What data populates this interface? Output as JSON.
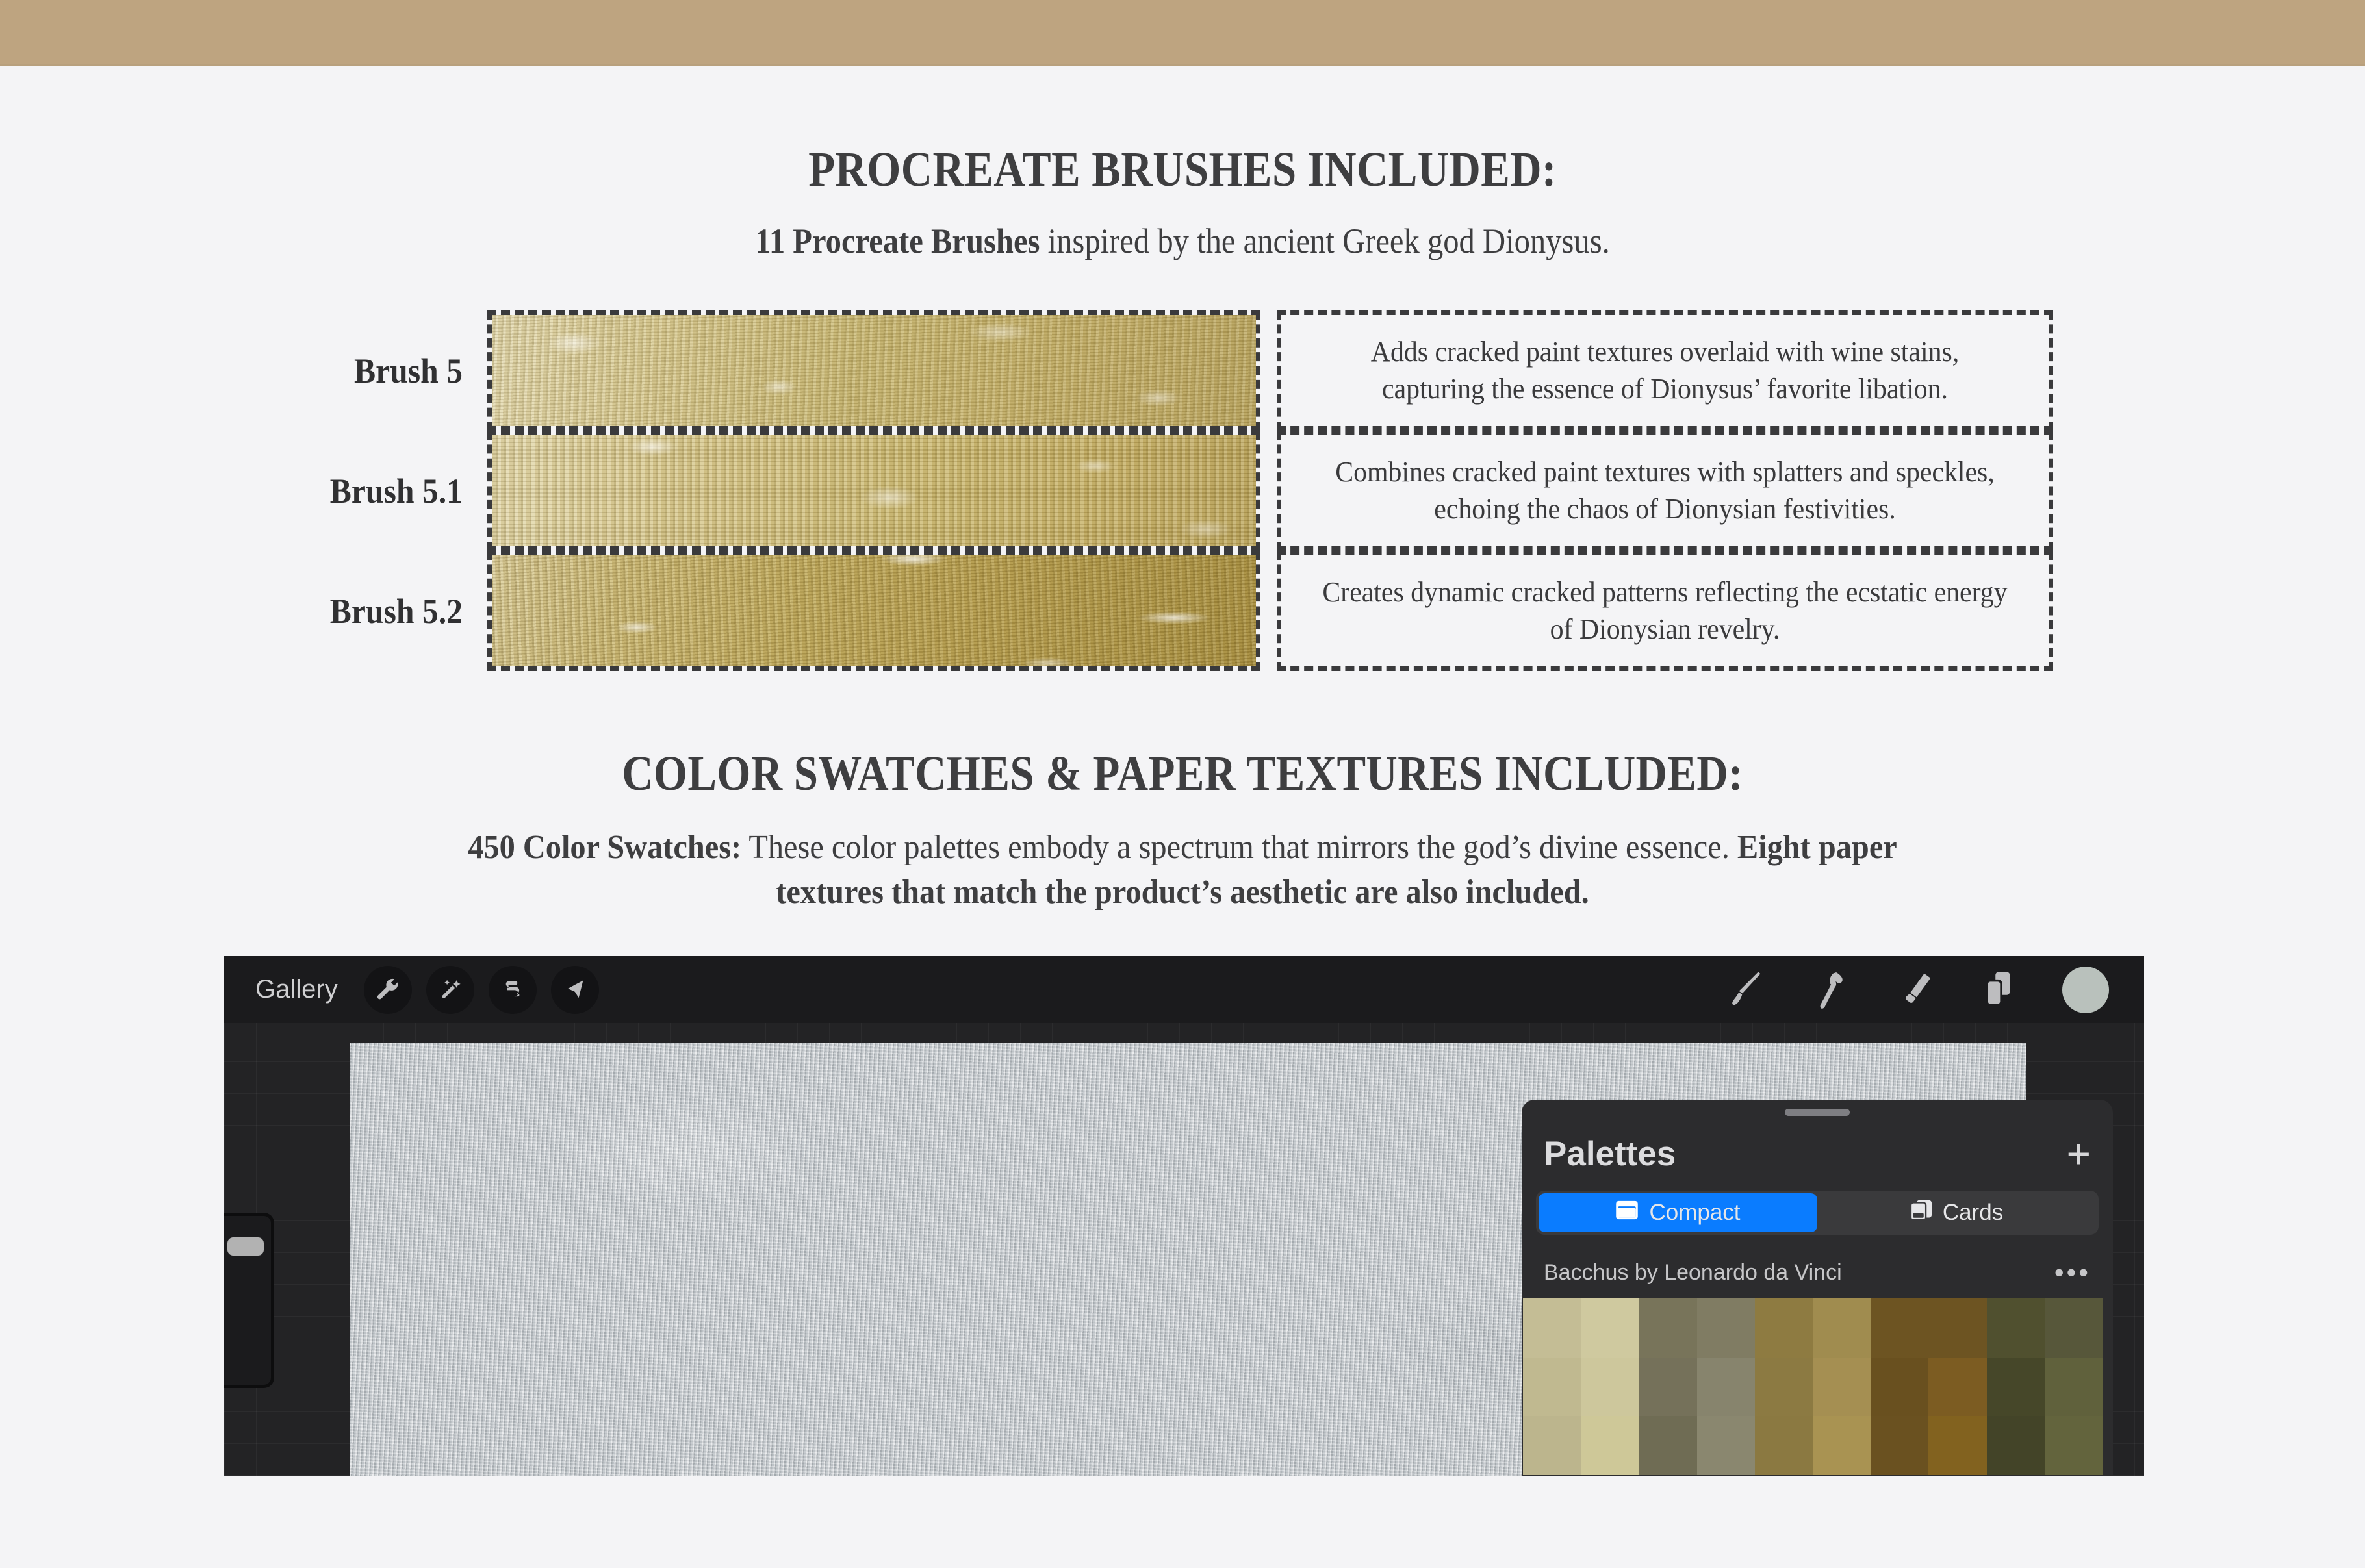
{
  "headings": {
    "brushes": "PROCREATE BRUSHES INCLUDED:",
    "swatches": "COLOR SWATCHES & PAPER TEXTURES INCLUDED:"
  },
  "subtitles": {
    "brushes_bold": "11 Procreate Brushes",
    "brushes_rest": " inspired by the ancient Greek god Dionysus.",
    "swatches_bold_1": "450 Color Swatches:",
    "swatches_rest_1": " These color palettes embody a spectrum that mirrors the god’s divine essence. ",
    "swatches_bold_2": "Eight paper textures that match the product’s aesthetic are also included."
  },
  "brushes": [
    {
      "label": "Brush 5",
      "description": "Adds cracked paint textures overlaid with wine stains, capturing the essence of Dionysus’ favorite libation."
    },
    {
      "label": "Brush 5.1",
      "description": "Combines cracked paint textures with splatters and speckles, echoing the chaos of Dionysian festivities."
    },
    {
      "label": "Brush 5.2",
      "description": "Creates dynamic cracked patterns reflecting the ecstatic energy of Dionysian revelry."
    }
  ],
  "procreate": {
    "toolbar": {
      "gallery_label": "Gallery",
      "left_icons": [
        "wrench-icon",
        "magic-wand-icon",
        "selection-icon",
        "transform-arrow-icon"
      ],
      "right_icons": [
        "paintbrush-icon",
        "smudge-icon",
        "eraser-icon",
        "layers-icon",
        "color-swatch-icon"
      ]
    },
    "palettes": {
      "title": "Palettes",
      "add_label": "+",
      "segments": [
        {
          "label": "Compact",
          "icon": "compact-view-icon",
          "active": true
        },
        {
          "label": "Cards",
          "icon": "cards-view-icon",
          "active": false
        }
      ],
      "palette_name": "Bacchus by Leonardo da Vinci",
      "more_label": "•••",
      "swatch_colors": [
        "#c4bd95",
        "#cfc99f",
        "#78745a",
        "#807c63",
        "#8e7b41",
        "#a08c4f",
        "#6d5422",
        "#6d5422",
        "#50502f",
        "#57573a",
        "#c0b990",
        "#cdc79c",
        "#75715a",
        "#87846d",
        "#8c7a42",
        "#a58f52",
        "#69501f",
        "#7c5c22",
        "#464729",
        "#60613c",
        "#bcb58d",
        "#cec898",
        "#6f6c54",
        "#8a876f",
        "#8b7941",
        "#a99352",
        "#6a5120",
        "#82621f",
        "#434428",
        "#63643d"
      ]
    }
  },
  "colors": {
    "banner": "#bea480",
    "page_background": "#f4f4f6",
    "text": "#3e3e40",
    "accent_blue": "#0a7cff",
    "panel_background": "#2c2c2e",
    "toolbar_background": "#1b1b1d"
  }
}
